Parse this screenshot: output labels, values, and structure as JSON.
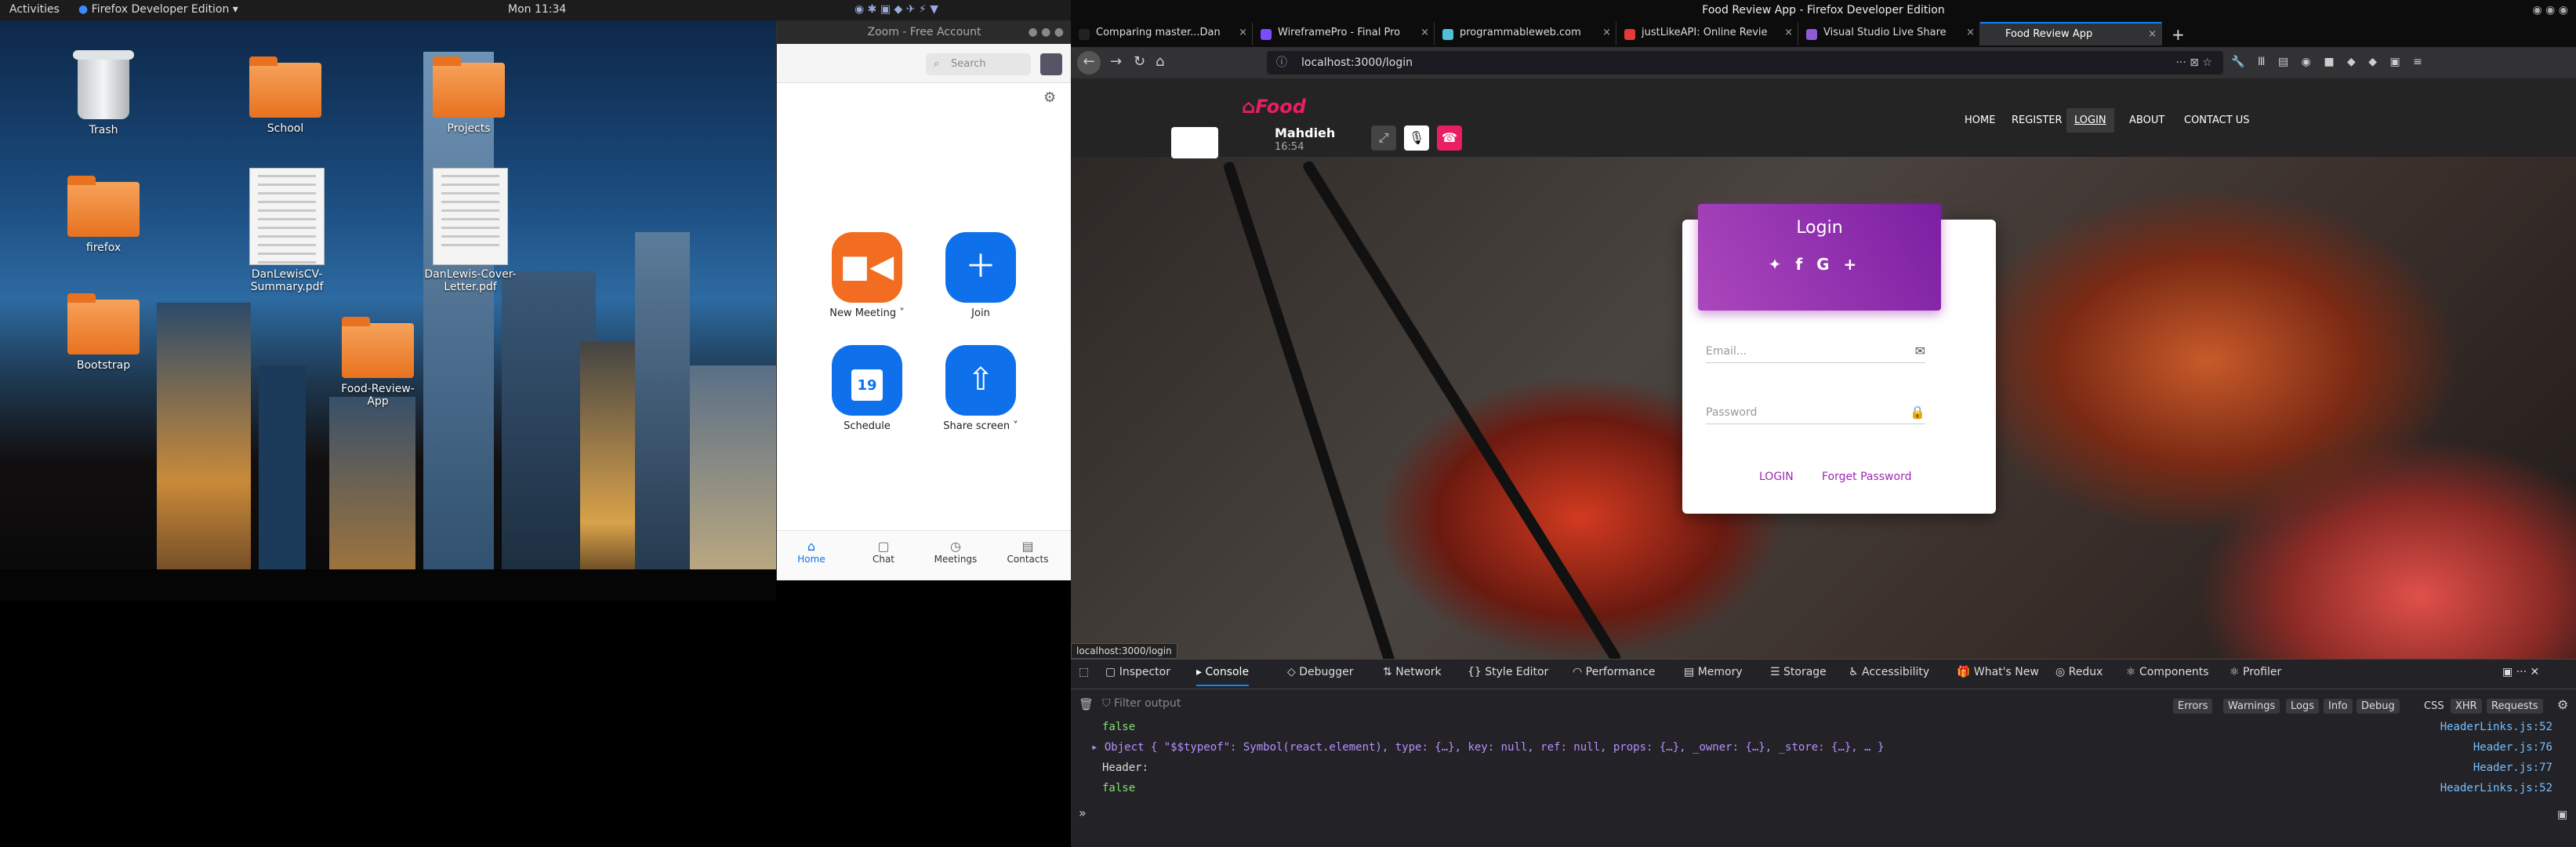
{
  "gnome_bar": {
    "activities": "Activities",
    "app": "Firefox Developer Edition",
    "clock": "Mon 11:34"
  },
  "desktop": {
    "icons": [
      {
        "label": "Trash"
      },
      {
        "label": "School"
      },
      {
        "label": "Projects"
      },
      {
        "label": "firefox"
      },
      {
        "label": "DanLewisCV-Summary.pdf"
      },
      {
        "label": "DanLewis-Cover-Letter.pdf"
      },
      {
        "label": "Bootstrap"
      },
      {
        "label": "Food-Review-App"
      }
    ]
  },
  "zoom": {
    "title": "Zoom - Free Account",
    "search_placeholder": "Search",
    "actions": [
      {
        "label": "New Meeting",
        "color": "#f26d21"
      },
      {
        "label": "Join",
        "color": "#0e71eb"
      },
      {
        "label": "Schedule",
        "color": "#0e71eb",
        "day": "19"
      },
      {
        "label": "Share screen",
        "color": "#0e71eb"
      }
    ],
    "nav": [
      {
        "label": "Home"
      },
      {
        "label": "Chat"
      },
      {
        "label": "Meetings"
      },
      {
        "label": "Contacts"
      }
    ]
  },
  "firefox": {
    "window_title": "Food Review App - Firefox Developer Edition",
    "tabs": [
      {
        "title": "Comparing master...Dan"
      },
      {
        "title": "WireframePro - Final Pro"
      },
      {
        "title": "programmableweb.com"
      },
      {
        "title": "justLikeAPI: Online Revie"
      },
      {
        "title": "Visual Studio Live Share"
      },
      {
        "title": "Food Review App"
      }
    ],
    "url": "localhost:3000/login",
    "status_url": "localhost:3000/login"
  },
  "site": {
    "logo": "Food",
    "user_name": "Mahdieh",
    "user_time": "16:54",
    "nav": [
      "HOME",
      "REGISTER",
      "LOGIN",
      "ABOUT",
      "CONTACT US"
    ],
    "login": {
      "title": "Login",
      "email_placeholder": "Email...",
      "password_placeholder": "Password",
      "login_button": "LOGIN",
      "forget_button": "Forget Password"
    }
  },
  "devtools": {
    "tabs": [
      "Inspector",
      "Console",
      "Debugger",
      "Network",
      "Style Editor",
      "Performance",
      "Memory",
      "Storage",
      "Accessibility",
      "What's New",
      "Redux",
      "Components",
      "Profiler"
    ],
    "filter_placeholder": "Filter output",
    "filters": [
      "Errors",
      "Warnings",
      "Logs",
      "Info",
      "Debug"
    ],
    "req_filters": [
      "CSS",
      "XHR",
      "Requests"
    ],
    "logs": [
      {
        "text": "false",
        "source": "HeaderLinks.js:52"
      },
      {
        "text": "Object { \"$$typeof\": Symbol(react.element), type: {…}, key: null, ref: null, props: {…}, _owner: {…}, _store: {…}, … }",
        "source": "Header.js:76"
      },
      {
        "text": "Header:",
        "source": "Header.js:77"
      },
      {
        "text": "false",
        "source": "HeaderLinks.js:52"
      }
    ]
  }
}
